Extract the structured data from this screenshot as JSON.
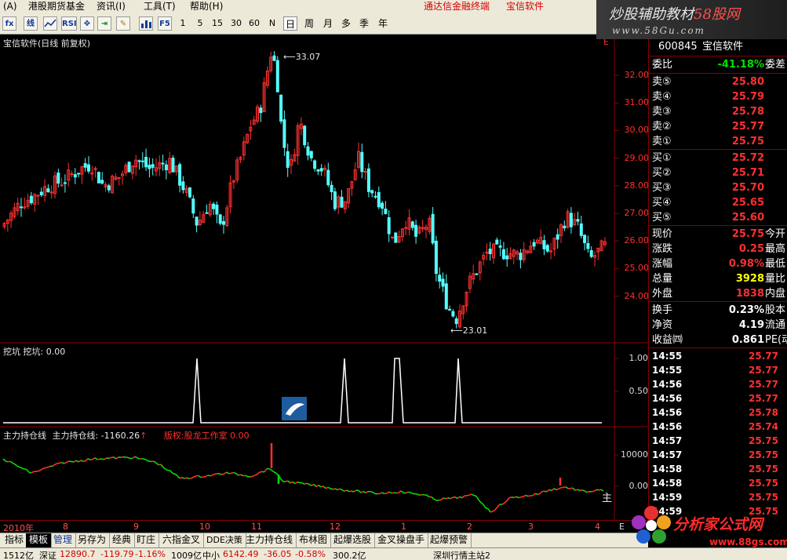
{
  "menu": {
    "items": [
      "(A)",
      "港股期货基金",
      "资讯(I)",
      "工具(T)",
      "帮助(H)"
    ],
    "promo": "通达信金融终端",
    "promo2": "宝信软件"
  },
  "toolbar": {
    "icon_buttons": [
      "fx",
      "线",
      "RSI",
      "✥",
      "⇥",
      "✎",
      "F5"
    ],
    "periods": [
      "1",
      "5",
      "15",
      "30",
      "60",
      "N",
      "日",
      "周",
      "月",
      "多",
      "季",
      "年"
    ],
    "selected_period": "日"
  },
  "watermark": {
    "line1_a": "炒股辅助教材",
    "line1_b": "58股网",
    "line2": "www.58Gu.com"
  },
  "main_pane": {
    "title": "宝信软件(日线 前复权)",
    "high_label": "33.07",
    "low_label": "23.01",
    "yaxis": [
      "32.00",
      "31.00",
      "30.00",
      "29.00",
      "28.00",
      "27.00",
      "26.00",
      "25.00",
      "24.00"
    ],
    "right_mark": "E"
  },
  "pane2": {
    "title": "挖坑 挖坑: 0.00",
    "yaxis": [
      "1.00",
      "0.50"
    ]
  },
  "pane3": {
    "title": "主力持仓线",
    "value_label": "主力持仓线: -1160.26",
    "arrow": "↑",
    "credit": "版权:股龙工作室 0.00",
    "yaxis": [
      "10000",
      "0.00"
    ],
    "side_label": "主"
  },
  "time_axis": [
    "2010年",
    "8",
    "9",
    "10",
    "11",
    "12",
    "1",
    "2",
    "3",
    "4"
  ],
  "time_axis_end": "E",
  "tabs": [
    "指标",
    "模板",
    "管理",
    "另存为",
    "经典",
    "盯庄",
    "六指金叉",
    "DDE决策",
    "主力持仓线",
    "布林图",
    "起爆选股",
    "金叉操盘手",
    "起爆预警"
  ],
  "active_tab": "模板",
  "quote": {
    "code": "600845",
    "name": "宝信软件",
    "wei": {
      "label": "委比",
      "value": "-41.18%",
      "extra": "委差"
    },
    "asks": [
      {
        "label": "卖⑤",
        "price": "25.80"
      },
      {
        "label": "卖④",
        "price": "25.79"
      },
      {
        "label": "卖③",
        "price": "25.78"
      },
      {
        "label": "卖②",
        "price": "25.77"
      },
      {
        "label": "卖①",
        "price": "25.75"
      }
    ],
    "bids": [
      {
        "label": "买①",
        "price": "25.72"
      },
      {
        "label": "买②",
        "price": "25.71"
      },
      {
        "label": "买③",
        "price": "25.70"
      },
      {
        "label": "买④",
        "price": "25.65"
      },
      {
        "label": "买⑤",
        "price": "25.60"
      }
    ],
    "stats": [
      {
        "label": "现价",
        "value": "25.75",
        "extra": "今开",
        "color": "red"
      },
      {
        "label": "涨跌",
        "value": "0.25",
        "extra": "最高",
        "color": "red"
      },
      {
        "label": "涨幅",
        "value": "0.98%",
        "extra": "最低",
        "color": "red"
      },
      {
        "label": "总量",
        "value": "3928",
        "extra": "量比",
        "color": "yellow"
      },
      {
        "label": "外盘",
        "value": "1838",
        "extra": "内盘",
        "color": "red"
      }
    ],
    "stats2": [
      {
        "label": "换手",
        "value": "0.23%",
        "extra": "股本"
      },
      {
        "label": "净资",
        "value": "4.19",
        "extra": "流通"
      },
      {
        "label": "收益㈣",
        "value": "0.861",
        "extra": "PE(动)"
      }
    ],
    "ticks": [
      {
        "time": "14:55",
        "price": "25.77"
      },
      {
        "time": "14:55",
        "price": "25.77"
      },
      {
        "time": "14:56",
        "price": "25.77"
      },
      {
        "time": "14:56",
        "price": "25.77"
      },
      {
        "time": "14:56",
        "price": "25.78"
      },
      {
        "time": "14:56",
        "price": "25.74"
      },
      {
        "time": "14:57",
        "price": "25.75"
      },
      {
        "time": "14:57",
        "price": "25.75"
      },
      {
        "time": "14:58",
        "price": "25.75"
      },
      {
        "time": "14:58",
        "price": "25.75"
      },
      {
        "time": "14:59",
        "price": "25.75"
      },
      {
        "time": "14:59",
        "price": "25.75"
      }
    ]
  },
  "logo2": {
    "name": "分析家公式网",
    "url": "www.88gs.com"
  },
  "status": [
    "1512亿",
    "深证",
    "12890.7",
    "-119.79",
    "-1.16%",
    "1009亿",
    "中小",
    "6142.49",
    "-36.05",
    "-0.58%",
    "300.2亿",
    "深圳行情主站2"
  ],
  "colors": {
    "up": "#ff3030",
    "down": "#54ffff",
    "axis": "#880000",
    "green_line": "#00e000"
  }
}
